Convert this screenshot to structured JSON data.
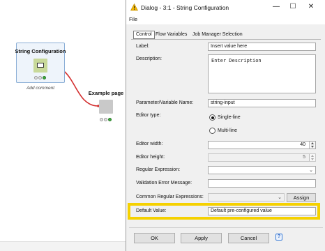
{
  "workflow": {
    "node1": {
      "name": "String Configuration",
      "comment": "Add comment"
    },
    "node2": {
      "name": "Example page"
    },
    "colors": {
      "wire": "#d32f2f",
      "node_config": "#c8d99a",
      "node_component": "#c9c9c9",
      "status_ok": "#3da93d"
    }
  },
  "dialog": {
    "title": "Dialog - 3:1 - String Configuration",
    "menu": {
      "file": "File"
    },
    "title_controls": {
      "minimize": "—",
      "maximize": "☐",
      "close": "✕"
    },
    "tabs": [
      "Control",
      "Flow Variables",
      "Job Manager Selection"
    ],
    "form": {
      "label": {
        "label": "Label:",
        "value": "Insert value here"
      },
      "description": {
        "label": "Description:",
        "value": "Enter Description"
      },
      "parameter": {
        "label": "Parameter/Variable Name:",
        "value": "string-input"
      },
      "editor_type": {
        "label": "Editor type:",
        "options": [
          "Single-line",
          "Multi-line"
        ],
        "selected": "Single-line"
      },
      "editor_width": {
        "label": "Editor width:",
        "value": "40"
      },
      "editor_height": {
        "label": "Editor height:",
        "value": "5"
      },
      "regex": {
        "label": "Regular Expression:",
        "value": ""
      },
      "validation": {
        "label": "Validation Error Message:",
        "value": ""
      },
      "common_regex": {
        "label": "Common Regular Expressions:",
        "value": "",
        "assign": "Assign"
      },
      "default_value": {
        "label": "Default Value:",
        "value": "Default pre-configured value"
      }
    },
    "buttons": {
      "ok": "OK",
      "apply": "Apply",
      "cancel": "Cancel",
      "help": "?"
    },
    "highlight_color": "#f5d100"
  }
}
